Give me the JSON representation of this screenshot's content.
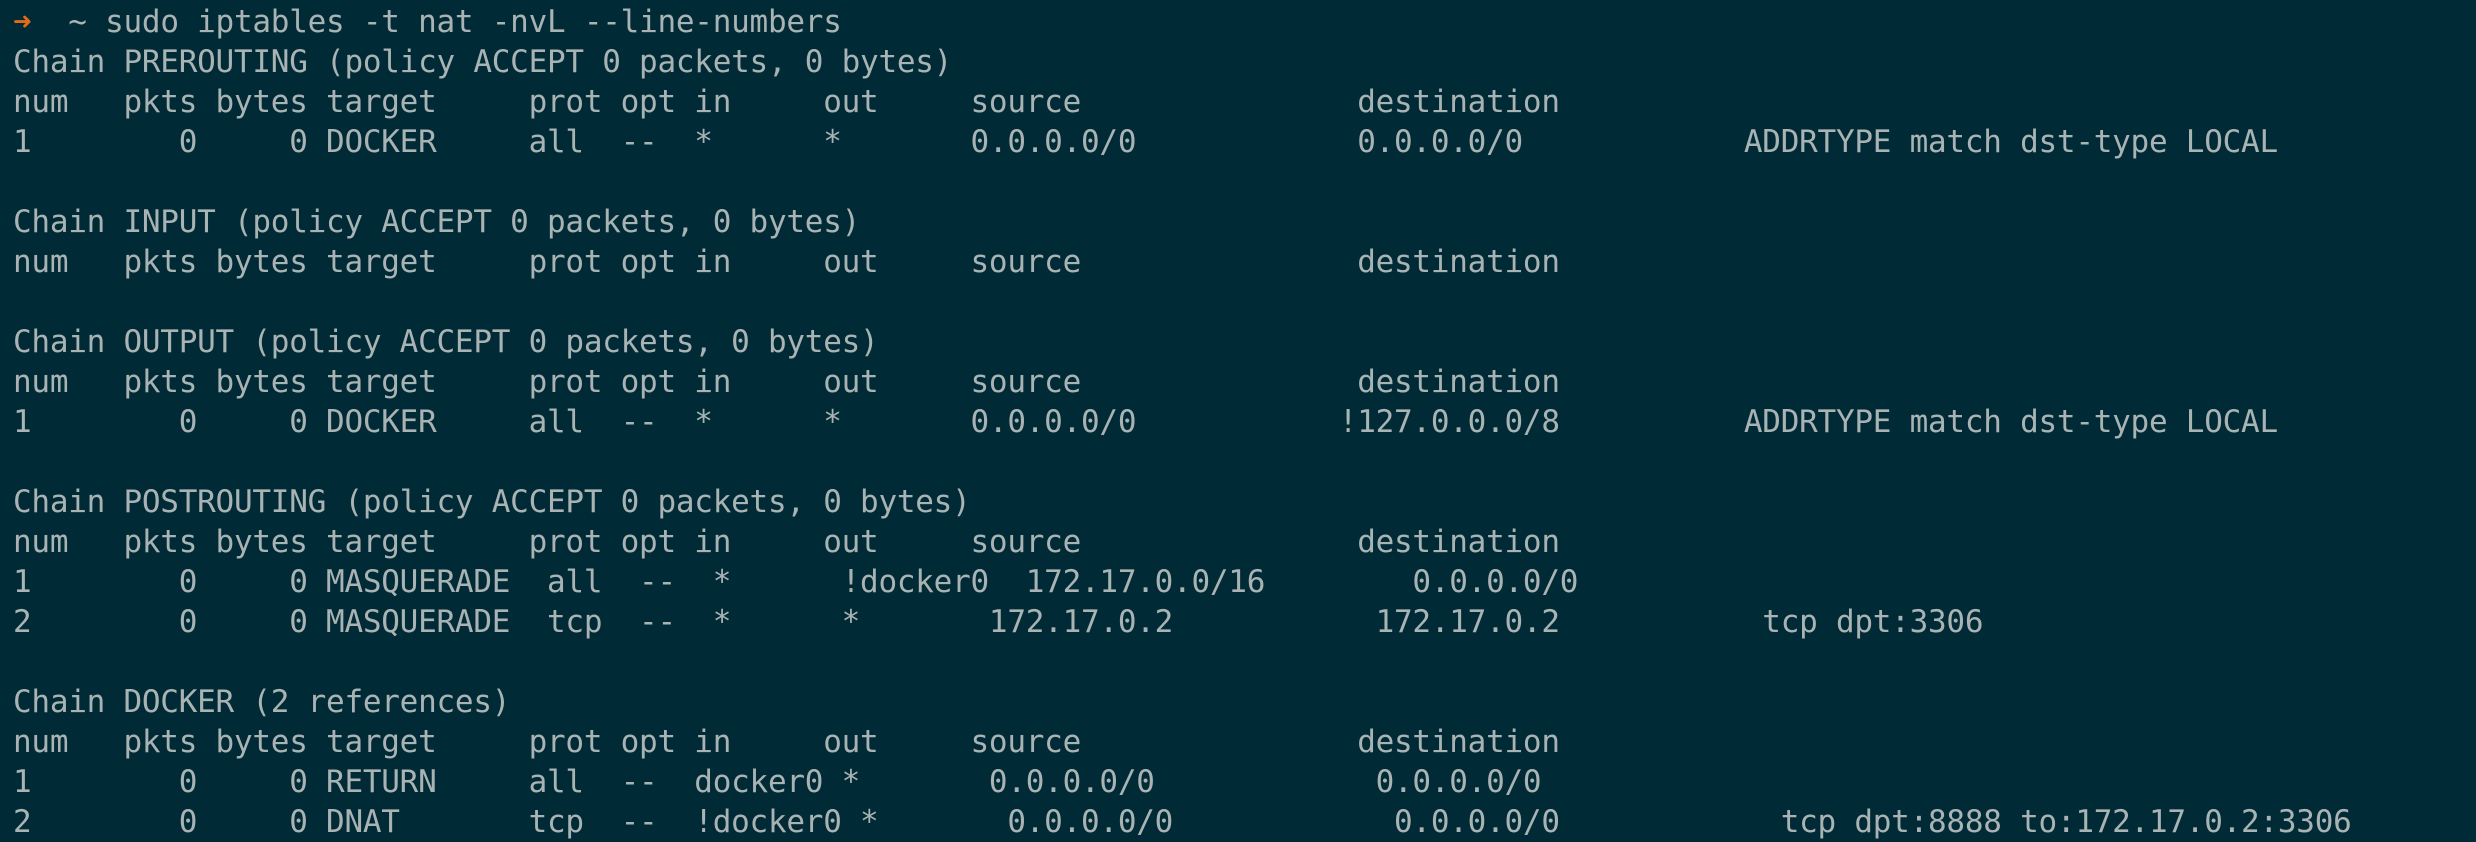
{
  "terminal": {
    "prompt_symbol": "➜",
    "command": "  ~ sudo iptables -t nat -nvL --line-numbers",
    "lines": [
      "Chain PREROUTING (policy ACCEPT 0 packets, 0 bytes)",
      "num   pkts bytes target     prot opt in     out     source               destination",
      "1        0     0 DOCKER     all  --  *      *       0.0.0.0/0            0.0.0.0/0            ADDRTYPE match dst-type LOCAL",
      "",
      "Chain INPUT (policy ACCEPT 0 packets, 0 bytes)",
      "num   pkts bytes target     prot opt in     out     source               destination",
      "",
      "Chain OUTPUT (policy ACCEPT 0 packets, 0 bytes)",
      "num   pkts bytes target     prot opt in     out     source               destination",
      "1        0     0 DOCKER     all  --  *      *       0.0.0.0/0           !127.0.0.0/8          ADDRTYPE match dst-type LOCAL",
      "",
      "Chain POSTROUTING (policy ACCEPT 0 packets, 0 bytes)",
      "num   pkts bytes target     prot opt in     out     source               destination",
      "1        0     0 MASQUERADE  all  --  *      !docker0  172.17.0.0/16        0.0.0.0/0",
      "2        0     0 MASQUERADE  tcp  --  *      *       172.17.0.2           172.17.0.2           tcp dpt:3306",
      "",
      "Chain DOCKER (2 references)",
      "num   pkts bytes target     prot opt in     out     source               destination",
      "1        0     0 RETURN     all  --  docker0 *       0.0.0.0/0            0.0.0.0/0",
      "2        0     0 DNAT       tcp  --  !docker0 *       0.0.0.0/0            0.0.0.0/0            tcp dpt:8888 to:172.17.0.2:3306"
    ]
  },
  "colors": {
    "background": "#002b36",
    "text": "#a9b3b4",
    "prompt_arrow": "#e06c1a"
  }
}
